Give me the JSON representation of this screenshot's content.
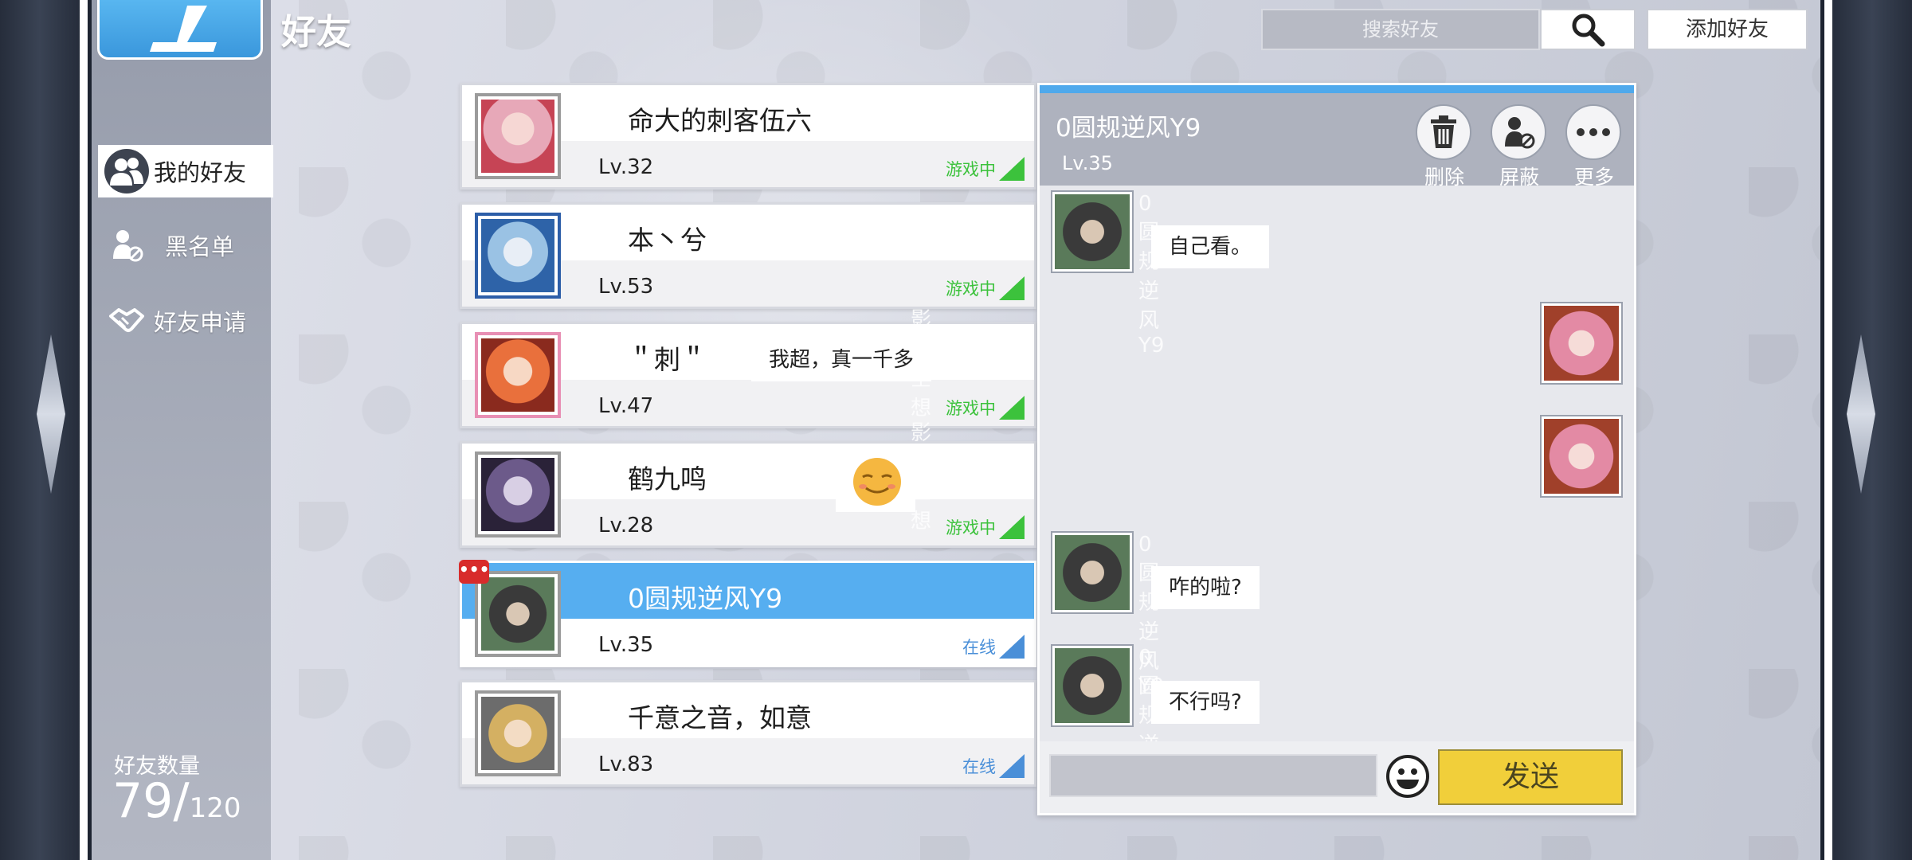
{
  "window": {
    "title": "好友"
  },
  "nav": {
    "items": [
      {
        "label": "我的好友",
        "icon": "friends-icon",
        "active": true
      },
      {
        "label": "黑名单",
        "icon": "blacklist-icon",
        "active": false
      },
      {
        "label": "好友申请",
        "icon": "handshake-icon",
        "active": false
      }
    ],
    "count_label": "好友数量",
    "count": "79/",
    "count_max": "120"
  },
  "topbar": {
    "search_placeholder": "搜索好友",
    "search_icon": "search-icon",
    "add_friend_label": "添加好友"
  },
  "friends": [
    {
      "name": "命大的刺客伍六",
      "level": "Lv.32",
      "status": "游戏中",
      "status_type": "ingame"
    },
    {
      "name": "本丶兮",
      "level": "Lv.53",
      "status": "游戏中",
      "status_type": "ingame"
    },
    {
      "name": "＂刺＂",
      "level": "Lv.47",
      "status": "游戏中",
      "status_type": "ingame"
    },
    {
      "name": "鹤九鸣",
      "level": "Lv.28",
      "status": "游戏中",
      "status_type": "ingame"
    },
    {
      "name": "0圆规逆风Y9",
      "level": "Lv.35",
      "status": "在线",
      "status_type": "online",
      "selected": true,
      "has_message": true
    },
    {
      "name": "千意之音，如意",
      "level": "Lv.83",
      "status": "在线",
      "status_type": "online"
    }
  ],
  "chat": {
    "title": "0圆规逆风Y9",
    "level": "Lv.35",
    "actions": [
      {
        "label": "删除",
        "icon": "trash-icon"
      },
      {
        "label": "屏蔽",
        "icon": "block-user-icon"
      },
      {
        "label": "更多",
        "icon": "more-icon"
      }
    ],
    "messages": [
      {
        "sender": "0圆规逆风Y9",
        "text": "自己看。",
        "side": "left"
      },
      {
        "sender": "影心空想",
        "text": "我超，真一千多",
        "side": "right"
      },
      {
        "sender": "影心空想",
        "text": "",
        "side": "right",
        "emoji": "smiley-sticker"
      },
      {
        "sender": "0圆规逆风Y9",
        "text": "咋的啦?",
        "side": "left"
      },
      {
        "sender": "0圆规逆风Y9",
        "text": "不行吗?",
        "side": "left"
      }
    ],
    "send_label": "发送"
  },
  "colors": {
    "accent_blue": "#56aef0",
    "ingame_green": "#3cc23c",
    "online_blue": "#4a8fd8",
    "send_yellow": "#f1cf3a"
  }
}
